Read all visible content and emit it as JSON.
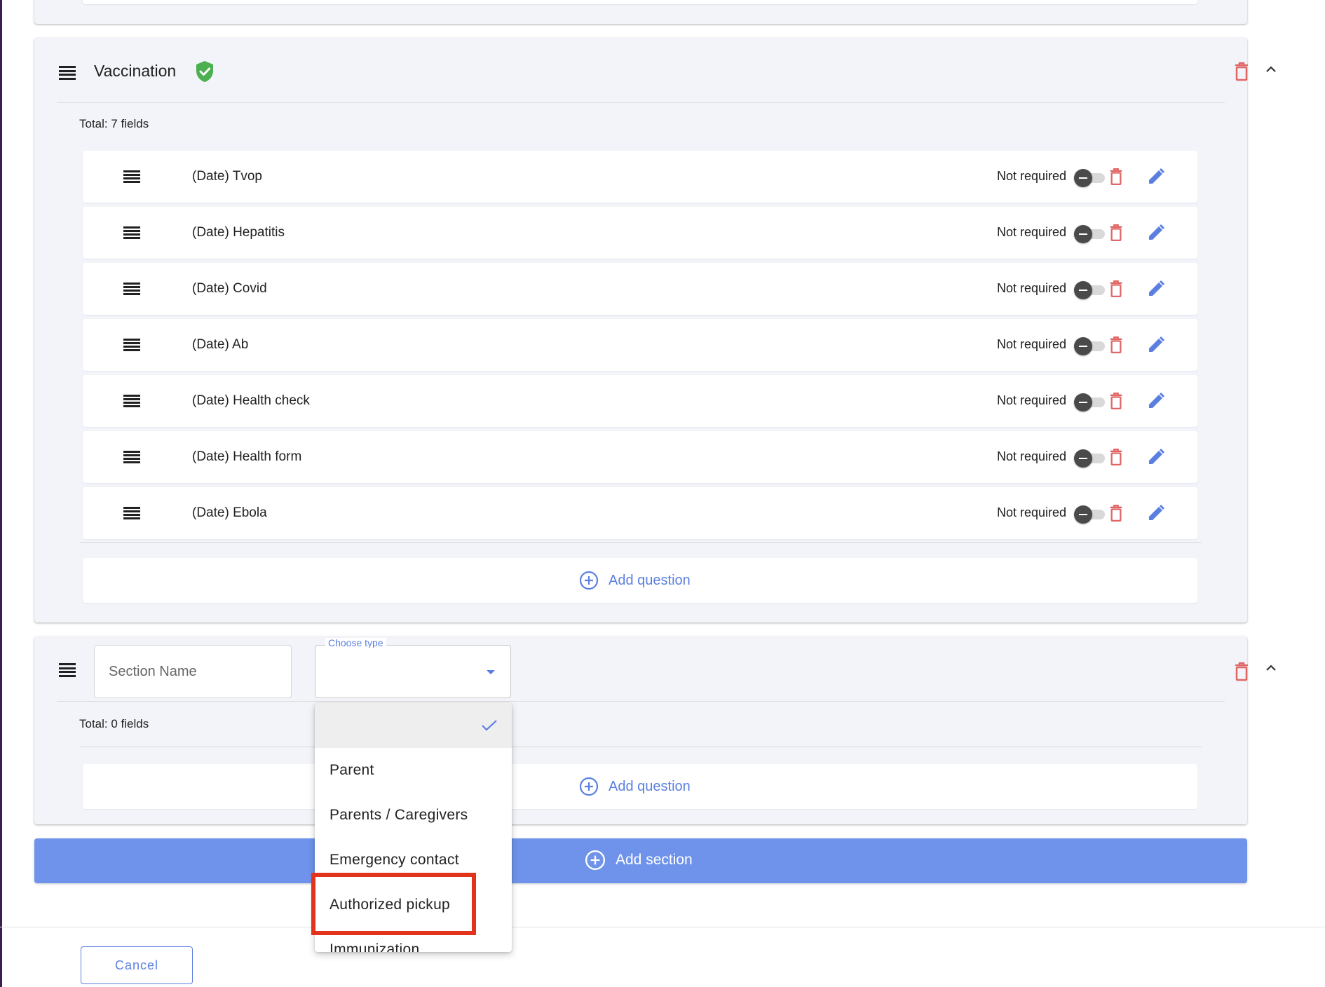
{
  "colors": {
    "accent": "#5b7fe0",
    "delete": "#e06666",
    "success": "#4caf50",
    "highlight": "#e2341d",
    "add_section_bg": "#6f93ea"
  },
  "vaccination_section": {
    "title": "Vaccination",
    "status_icon": "shield-check-icon",
    "total": "Total: 7 fields",
    "fields": [
      {
        "label": "(Date) Tvop",
        "required_label": "Not required"
      },
      {
        "label": "(Date) Hepatitis",
        "required_label": "Not required"
      },
      {
        "label": "(Date) Covid",
        "required_label": "Not required"
      },
      {
        "label": "(Date) Ab",
        "required_label": "Not required"
      },
      {
        "label": "(Date) Health check",
        "required_label": "Not required"
      },
      {
        "label": "(Date) Health form",
        "required_label": "Not required"
      },
      {
        "label": "(Date) Ebola",
        "required_label": "Not required"
      }
    ],
    "add_question": "Add question"
  },
  "new_section": {
    "name_placeholder": "Section Name",
    "type_label": "Choose type",
    "total": "Total: 0 fields",
    "add_question": "Add question"
  },
  "type_dropdown": {
    "options": [
      "",
      "Parent",
      "Parents / Caregivers",
      "Emergency contact",
      "Authorized pickup",
      "Immunization"
    ],
    "selected_index": 0,
    "highlighted_option": "Authorized pickup"
  },
  "add_section_label": "Add section",
  "footer": {
    "cancel_label": "Cancel"
  }
}
